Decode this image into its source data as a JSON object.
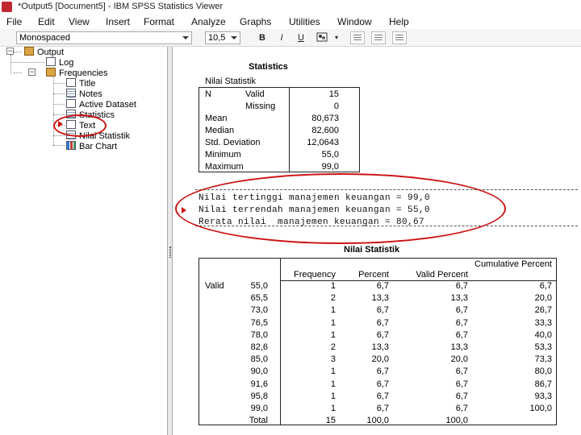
{
  "window": {
    "title": "*Output5 [Document5] - IBM SPSS Statistics Viewer"
  },
  "menu": [
    "File",
    "Edit",
    "View",
    "Insert",
    "Format",
    "Analyze",
    "Graphs",
    "Utilities",
    "Window",
    "Help"
  ],
  "toolbar": {
    "font_value": "Monospaced",
    "size_value": "10,5",
    "bold": "B",
    "italic": "I",
    "underline": "U"
  },
  "outline": {
    "root": "Output",
    "log": "Log",
    "frequencies": "Frequencies",
    "children": [
      "Title",
      "Notes",
      "Active Dataset",
      "Statistics",
      "Text",
      "Nilai Statistik",
      "Bar Chart"
    ],
    "selected": "Text"
  },
  "statistics": {
    "title": "Statistics",
    "variable": "Nilai Statistik",
    "rows": [
      {
        "label": "N",
        "sub": "Valid",
        "value": "15"
      },
      {
        "label": "",
        "sub": "Missing",
        "value": "0"
      },
      {
        "label": "Mean",
        "sub": "",
        "value": "80,673"
      },
      {
        "label": "Median",
        "sub": "",
        "value": "82,600"
      },
      {
        "label": "Std. Deviation",
        "sub": "",
        "value": "12,0643"
      },
      {
        "label": "Minimum",
        "sub": "",
        "value": "55,0"
      },
      {
        "label": "Maximum",
        "sub": "",
        "value": "99,0"
      }
    ]
  },
  "text_output": {
    "lines": [
      "Nilai tertinggi manajemen keuangan = 99,0",
      "Nilai terrendah manajemen keuangan = 55,0",
      "Rerata nilai  manajemen keuangan = 80,67"
    ]
  },
  "frequency_table": {
    "title": "Nilai Statistik",
    "headers": [
      "Frequency",
      "Percent",
      "Valid Percent",
      "Cumulative Percent"
    ],
    "group_label": "Valid",
    "rows": [
      {
        "value": "55,0",
        "freq": "1",
        "pct": "6,7",
        "valid": "6,7",
        "cum": "6,7"
      },
      {
        "value": "65,5",
        "freq": "2",
        "pct": "13,3",
        "valid": "13,3",
        "cum": "20,0"
      },
      {
        "value": "73,0",
        "freq": "1",
        "pct": "6,7",
        "valid": "6,7",
        "cum": "26,7"
      },
      {
        "value": "76,5",
        "freq": "1",
        "pct": "6,7",
        "valid": "6,7",
        "cum": "33,3"
      },
      {
        "value": "78,0",
        "freq": "1",
        "pct": "6,7",
        "valid": "6,7",
        "cum": "40,0"
      },
      {
        "value": "82,6",
        "freq": "2",
        "pct": "13,3",
        "valid": "13,3",
        "cum": "53,3"
      },
      {
        "value": "85,0",
        "freq": "3",
        "pct": "20,0",
        "valid": "20,0",
        "cum": "73,3"
      },
      {
        "value": "90,0",
        "freq": "1",
        "pct": "6,7",
        "valid": "6,7",
        "cum": "80,0"
      },
      {
        "value": "91,6",
        "freq": "1",
        "pct": "6,7",
        "valid": "6,7",
        "cum": "86,7"
      },
      {
        "value": "95,8",
        "freq": "1",
        "pct": "6,7",
        "valid": "6,7",
        "cum": "93,3"
      },
      {
        "value": "99,0",
        "freq": "1",
        "pct": "6,7",
        "valid": "6,7",
        "cum": "100,0"
      },
      {
        "value": "Total",
        "freq": "15",
        "pct": "100,0",
        "valid": "100,0",
        "cum": ""
      }
    ]
  },
  "colors": {
    "annotation_red": "#cc1111"
  }
}
